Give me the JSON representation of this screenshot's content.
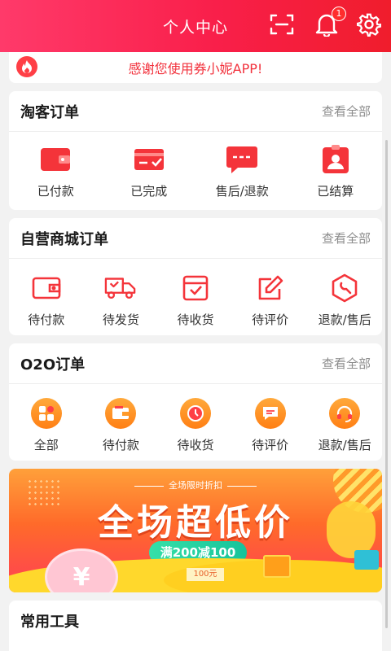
{
  "header": {
    "title": "个人中心",
    "notification_count": "1",
    "bg_color": "#f91f4a"
  },
  "notice": {
    "text": "感谢您使用券小妮APP!"
  },
  "taoke": {
    "title": "淘客订单",
    "more": "查看全部",
    "items": [
      {
        "label": "已付款",
        "icon": "wallet-icon"
      },
      {
        "label": "已完成",
        "icon": "card-check-icon"
      },
      {
        "label": "售后/退款",
        "icon": "chat-bubble-icon"
      },
      {
        "label": "已结算",
        "icon": "user-badge-icon"
      }
    ]
  },
  "mall": {
    "title": "自营商城订单",
    "more": "查看全部",
    "items": [
      {
        "label": "待付款",
        "icon": "wallet-outline-icon"
      },
      {
        "label": "待发货",
        "icon": "truck-icon"
      },
      {
        "label": "待收货",
        "icon": "box-check-icon"
      },
      {
        "label": "待评价",
        "icon": "edit-icon"
      },
      {
        "label": "退款/售后",
        "icon": "wrench-hex-icon"
      }
    ]
  },
  "o2o": {
    "title": "O2O订单",
    "more": "查看全部",
    "items": [
      {
        "label": "全部",
        "icon": "grid-icon"
      },
      {
        "label": "待付款",
        "icon": "wallet-icon"
      },
      {
        "label": "待收货",
        "icon": "clock-icon"
      },
      {
        "label": "待评价",
        "icon": "comment-icon"
      },
      {
        "label": "退款/售后",
        "icon": "headset-icon"
      }
    ]
  },
  "banner": {
    "subtitle": "全场限时折扣",
    "title": "全场超低价",
    "promo": "满200减100",
    "coupon": "100元",
    "coin": "¥"
  },
  "tools": {
    "title": "常用工具"
  }
}
